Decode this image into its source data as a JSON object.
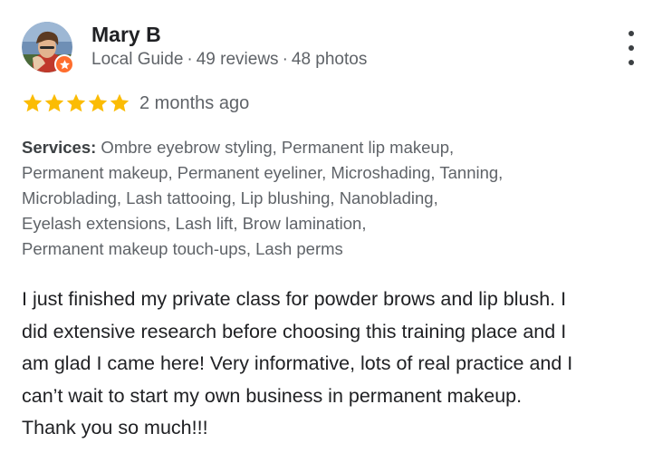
{
  "reviewer": {
    "name": "Mary B",
    "role": "Local Guide",
    "reviews": "49 reviews",
    "photos": "48 photos",
    "separator": "·"
  },
  "rating": {
    "stars": 5,
    "max_stars": 5,
    "date": "2 months ago",
    "star_color": "#fbbc04"
  },
  "services": {
    "label": "Services:",
    "lines": [
      " Ombre eyebrow styling, Permanent lip makeup,",
      "Permanent makeup, Permanent eyeliner, Microshading, Tanning,",
      "Microblading, Lash tattooing, Lip blushing, Nanoblading,",
      "Eyelash extensions, Lash lift, Brow lamination,",
      "Permanent makeup touch-ups, Lash perms"
    ]
  },
  "review": {
    "lines": [
      "I just finished my private class for powder brows and lip blush. I",
      "did extensive research before choosing this training place and I",
      "am glad I came here! Very informative, lots of real practice and I",
      "can’t wait to start my own business in permanent makeup.",
      "Thank you so much!!!"
    ]
  },
  "icons": {
    "menu": "more-vert-icon",
    "badge": "local-guide-star-icon",
    "star": "star-icon"
  },
  "colors": {
    "badge": "#ff6d2d",
    "meta_text": "#5f6368",
    "body_text": "#202124"
  }
}
